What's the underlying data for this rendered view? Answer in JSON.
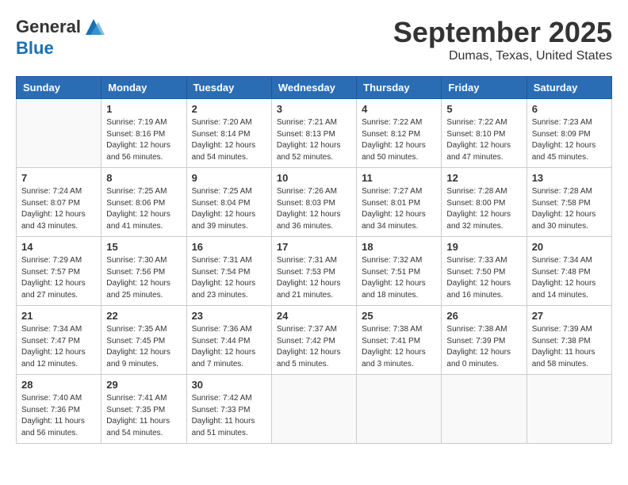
{
  "logo": {
    "general": "General",
    "blue": "Blue"
  },
  "title": "September 2025",
  "location": "Dumas, Texas, United States",
  "days_of_week": [
    "Sunday",
    "Monday",
    "Tuesday",
    "Wednesday",
    "Thursday",
    "Friday",
    "Saturday"
  ],
  "weeks": [
    [
      {
        "num": "",
        "info": ""
      },
      {
        "num": "1",
        "info": "Sunrise: 7:19 AM\nSunset: 8:16 PM\nDaylight: 12 hours\nand 56 minutes."
      },
      {
        "num": "2",
        "info": "Sunrise: 7:20 AM\nSunset: 8:14 PM\nDaylight: 12 hours\nand 54 minutes."
      },
      {
        "num": "3",
        "info": "Sunrise: 7:21 AM\nSunset: 8:13 PM\nDaylight: 12 hours\nand 52 minutes."
      },
      {
        "num": "4",
        "info": "Sunrise: 7:22 AM\nSunset: 8:12 PM\nDaylight: 12 hours\nand 50 minutes."
      },
      {
        "num": "5",
        "info": "Sunrise: 7:22 AM\nSunset: 8:10 PM\nDaylight: 12 hours\nand 47 minutes."
      },
      {
        "num": "6",
        "info": "Sunrise: 7:23 AM\nSunset: 8:09 PM\nDaylight: 12 hours\nand 45 minutes."
      }
    ],
    [
      {
        "num": "7",
        "info": "Sunrise: 7:24 AM\nSunset: 8:07 PM\nDaylight: 12 hours\nand 43 minutes."
      },
      {
        "num": "8",
        "info": "Sunrise: 7:25 AM\nSunset: 8:06 PM\nDaylight: 12 hours\nand 41 minutes."
      },
      {
        "num": "9",
        "info": "Sunrise: 7:25 AM\nSunset: 8:04 PM\nDaylight: 12 hours\nand 39 minutes."
      },
      {
        "num": "10",
        "info": "Sunrise: 7:26 AM\nSunset: 8:03 PM\nDaylight: 12 hours\nand 36 minutes."
      },
      {
        "num": "11",
        "info": "Sunrise: 7:27 AM\nSunset: 8:01 PM\nDaylight: 12 hours\nand 34 minutes."
      },
      {
        "num": "12",
        "info": "Sunrise: 7:28 AM\nSunset: 8:00 PM\nDaylight: 12 hours\nand 32 minutes."
      },
      {
        "num": "13",
        "info": "Sunrise: 7:28 AM\nSunset: 7:58 PM\nDaylight: 12 hours\nand 30 minutes."
      }
    ],
    [
      {
        "num": "14",
        "info": "Sunrise: 7:29 AM\nSunset: 7:57 PM\nDaylight: 12 hours\nand 27 minutes."
      },
      {
        "num": "15",
        "info": "Sunrise: 7:30 AM\nSunset: 7:56 PM\nDaylight: 12 hours\nand 25 minutes."
      },
      {
        "num": "16",
        "info": "Sunrise: 7:31 AM\nSunset: 7:54 PM\nDaylight: 12 hours\nand 23 minutes."
      },
      {
        "num": "17",
        "info": "Sunrise: 7:31 AM\nSunset: 7:53 PM\nDaylight: 12 hours\nand 21 minutes."
      },
      {
        "num": "18",
        "info": "Sunrise: 7:32 AM\nSunset: 7:51 PM\nDaylight: 12 hours\nand 18 minutes."
      },
      {
        "num": "19",
        "info": "Sunrise: 7:33 AM\nSunset: 7:50 PM\nDaylight: 12 hours\nand 16 minutes."
      },
      {
        "num": "20",
        "info": "Sunrise: 7:34 AM\nSunset: 7:48 PM\nDaylight: 12 hours\nand 14 minutes."
      }
    ],
    [
      {
        "num": "21",
        "info": "Sunrise: 7:34 AM\nSunset: 7:47 PM\nDaylight: 12 hours\nand 12 minutes."
      },
      {
        "num": "22",
        "info": "Sunrise: 7:35 AM\nSunset: 7:45 PM\nDaylight: 12 hours\nand 9 minutes."
      },
      {
        "num": "23",
        "info": "Sunrise: 7:36 AM\nSunset: 7:44 PM\nDaylight: 12 hours\nand 7 minutes."
      },
      {
        "num": "24",
        "info": "Sunrise: 7:37 AM\nSunset: 7:42 PM\nDaylight: 12 hours\nand 5 minutes."
      },
      {
        "num": "25",
        "info": "Sunrise: 7:38 AM\nSunset: 7:41 PM\nDaylight: 12 hours\nand 3 minutes."
      },
      {
        "num": "26",
        "info": "Sunrise: 7:38 AM\nSunset: 7:39 PM\nDaylight: 12 hours\nand 0 minutes."
      },
      {
        "num": "27",
        "info": "Sunrise: 7:39 AM\nSunset: 7:38 PM\nDaylight: 11 hours\nand 58 minutes."
      }
    ],
    [
      {
        "num": "28",
        "info": "Sunrise: 7:40 AM\nSunset: 7:36 PM\nDaylight: 11 hours\nand 56 minutes."
      },
      {
        "num": "29",
        "info": "Sunrise: 7:41 AM\nSunset: 7:35 PM\nDaylight: 11 hours\nand 54 minutes."
      },
      {
        "num": "30",
        "info": "Sunrise: 7:42 AM\nSunset: 7:33 PM\nDaylight: 11 hours\nand 51 minutes."
      },
      {
        "num": "",
        "info": ""
      },
      {
        "num": "",
        "info": ""
      },
      {
        "num": "",
        "info": ""
      },
      {
        "num": "",
        "info": ""
      }
    ]
  ]
}
